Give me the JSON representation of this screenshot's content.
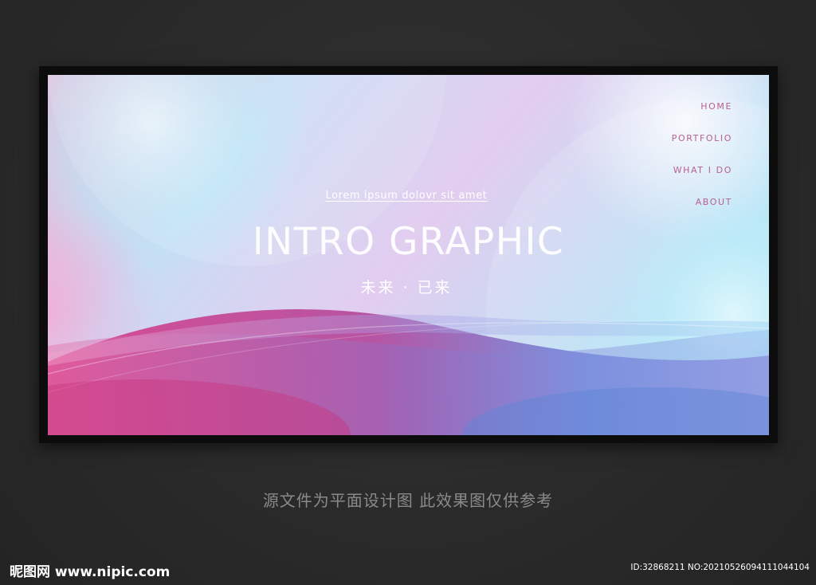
{
  "nav": {
    "items": [
      {
        "label": "HOME"
      },
      {
        "label": "PORTFOLIO"
      },
      {
        "label": "WHAT I DO"
      },
      {
        "label": "ABOUT"
      }
    ]
  },
  "hero": {
    "subtitle": "Lorem ipsum dolovr sit amet",
    "title": "INTRO GRAPHIC",
    "chinese_tagline": "未来 · 已来"
  },
  "caption": "源文件为平面设计图 此效果图仅供参考",
  "watermark": {
    "logo": "昵图网 www.nipic.com",
    "id": "ID:32868211 NO:20210526094111044104"
  },
  "colors": {
    "page_background": "#2a2a2a",
    "frame": "#0c0c0c",
    "nav_text": "#b8608e",
    "pink": "#e04a94",
    "blue": "#6f8fe0",
    "cyan": "#a8e6f6"
  }
}
